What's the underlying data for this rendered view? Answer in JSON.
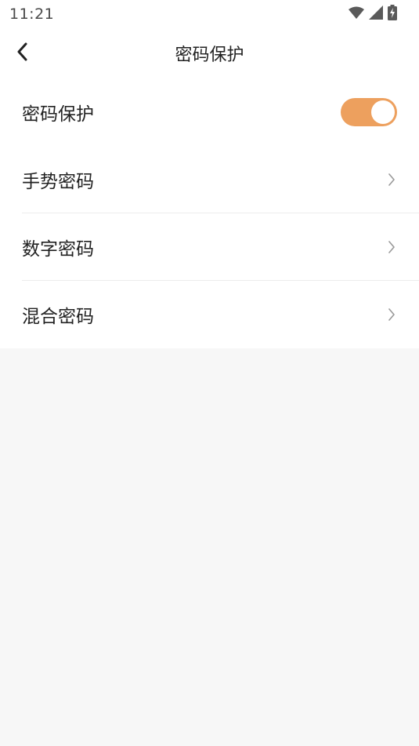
{
  "status_bar": {
    "time": "11:21",
    "icons": [
      "wifi-icon",
      "signal-icon",
      "battery-charging-icon"
    ]
  },
  "nav": {
    "back_icon": "chevron-left-icon",
    "title": "密码保护"
  },
  "settings": {
    "protection": {
      "label": "密码保护",
      "enabled": true
    },
    "items": [
      {
        "label": "手势密码",
        "icon": "chevron-right-icon"
      },
      {
        "label": "数字密码",
        "icon": "chevron-right-icon"
      },
      {
        "label": "混合密码",
        "icon": "chevron-right-icon"
      }
    ]
  },
  "colors": {
    "accent": "#eda05e",
    "page_background": "#f7f7f7",
    "card_background": "#ffffff",
    "divider": "#ececec",
    "chevron": "#999999"
  }
}
